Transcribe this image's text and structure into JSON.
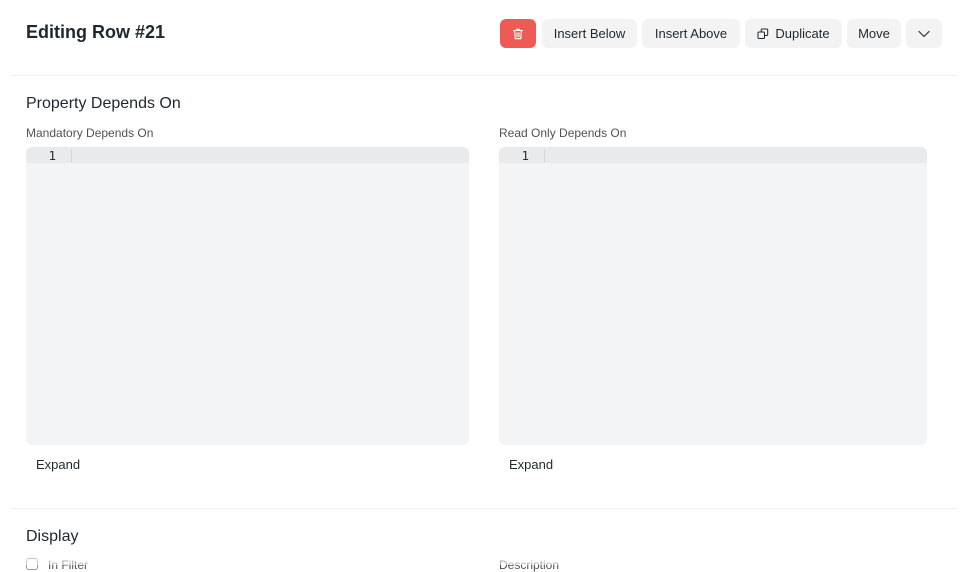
{
  "header": {
    "title": "Editing Row #21",
    "buttons": {
      "delete_icon": "trash-icon",
      "insert_below": "Insert Below",
      "insert_above": "Insert Above",
      "duplicate": "Duplicate",
      "duplicate_icon": "copy-icon",
      "move": "Move",
      "more_icon": "chevron-down-icon"
    }
  },
  "sections": {
    "property_depends_on": {
      "title": "Property Depends On",
      "mandatory": {
        "label": "Mandatory Depends On",
        "line_number": "1",
        "expand": "Expand"
      },
      "read_only": {
        "label": "Read Only Depends On",
        "line_number": "1",
        "expand": "Expand"
      }
    },
    "display": {
      "title": "Display",
      "in_filter_label": "In Filter",
      "description_label": "Description"
    }
  },
  "colors": {
    "delete_button": "#ef5a55",
    "button_bg": "#f3f3f3",
    "editor_bg": "#f3f4f6"
  }
}
